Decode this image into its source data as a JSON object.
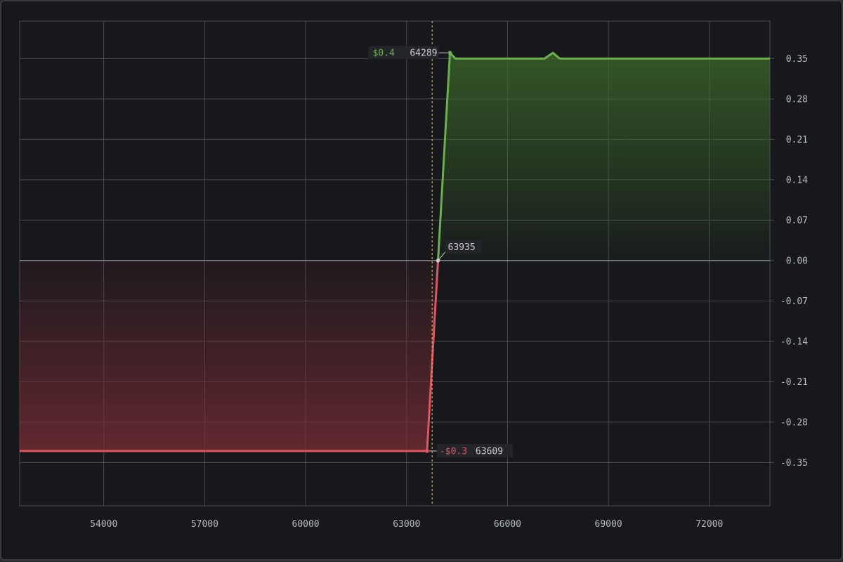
{
  "chart_data": {
    "type": "area",
    "title": "",
    "xlabel": "",
    "ylabel": "",
    "xlim": [
      51500,
      73800
    ],
    "ylim": [
      -0.425,
      0.415
    ],
    "grid": true,
    "y_axis_position": "right",
    "x_ticks": [
      54000,
      57000,
      60000,
      63000,
      66000,
      69000,
      72000
    ],
    "x_tick_labels": [
      "54000",
      "57000",
      "60000",
      "63000",
      "66000",
      "69000",
      "72000"
    ],
    "y_ticks": [
      0.35,
      0.28,
      0.21,
      0.14,
      0.07,
      0.0,
      -0.07,
      -0.14,
      -0.21,
      -0.28,
      -0.35
    ],
    "y_tick_labels": [
      "0.35",
      "0.28",
      "0.21",
      "0.14",
      "0.07",
      "0.00",
      "-0.07",
      "-0.14",
      "-0.21",
      "-0.28",
      "-0.35"
    ],
    "current_price": 63760,
    "series": [
      {
        "points": [
          [
            51500,
            -0.33
          ],
          [
            63609,
            -0.33
          ],
          [
            63935,
            0.0
          ],
          [
            64289,
            0.36
          ],
          [
            64450,
            0.35
          ],
          [
            67100,
            0.35
          ],
          [
            67350,
            0.36
          ],
          [
            67550,
            0.35
          ],
          [
            73800,
            0.35
          ]
        ]
      }
    ],
    "annotations": [
      {
        "x": 64289,
        "y": 0.36,
        "value_text": "$0.4",
        "price_text": "64289",
        "sign": "positive"
      },
      {
        "x": 63935,
        "y": 0.0,
        "value_text": "",
        "price_text": "63935",
        "sign": "zero"
      },
      {
        "x": 63609,
        "y": -0.33,
        "value_text": "-$0.3",
        "price_text": "63609",
        "sign": "negative"
      }
    ],
    "colors": {
      "profit_line": "#6ab04c",
      "loss_line": "#e0555f",
      "profit_fill": "#3d6b2a",
      "loss_fill": "#7a2d35",
      "grid": "#4a4b52",
      "zero_line": "#8a8c93",
      "current_price_line": "#e0a92a",
      "background": "#17181c"
    }
  }
}
